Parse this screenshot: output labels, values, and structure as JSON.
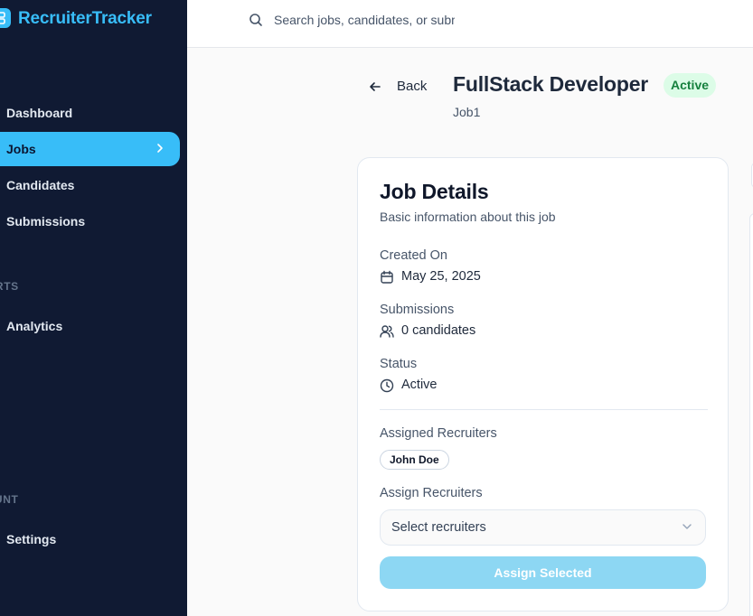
{
  "app": {
    "name": "RecruiterTracker"
  },
  "sidebar": {
    "sections": {
      "main": "",
      "reports": "ORTS",
      "account": "OUNT"
    },
    "items": [
      {
        "label": "Dashboard"
      },
      {
        "label": "Jobs",
        "active": true
      },
      {
        "label": "Candidates"
      },
      {
        "label": "Submissions"
      },
      {
        "label": "Analytics"
      },
      {
        "label": "Settings"
      }
    ]
  },
  "search": {
    "placeholder": "Search jobs, candidates, or submissions..."
  },
  "header": {
    "back_label": "Back",
    "title": "FullStack Developer",
    "status": "Active",
    "job_id": "Job1"
  },
  "card": {
    "title": "Job Details",
    "subtitle": "Basic information about this job",
    "created_label": "Created On",
    "created_value": "May 25, 2025",
    "submissions_label": "Submissions",
    "submissions_value": "0 candidates",
    "status_label": "Status",
    "status_value": "Active",
    "assigned_label": "Assigned Recruiters",
    "assigned": [
      "John Doe"
    ],
    "assign_label": "Assign Recruiters",
    "select_placeholder": "Select recruiters",
    "assign_button": "Assign Selected"
  },
  "colors": {
    "sidebar_bg": "#101a33",
    "accent": "#38bdf8",
    "status_bg": "#dcfce7",
    "status_text": "#15803d",
    "button_disabled": "#8dd7f3"
  },
  "icons": [
    "logo-icon",
    "search-icon",
    "chevron-right-icon",
    "arrow-left-icon",
    "calendar-icon",
    "users-icon",
    "clock-icon",
    "chevron-down-icon"
  ]
}
